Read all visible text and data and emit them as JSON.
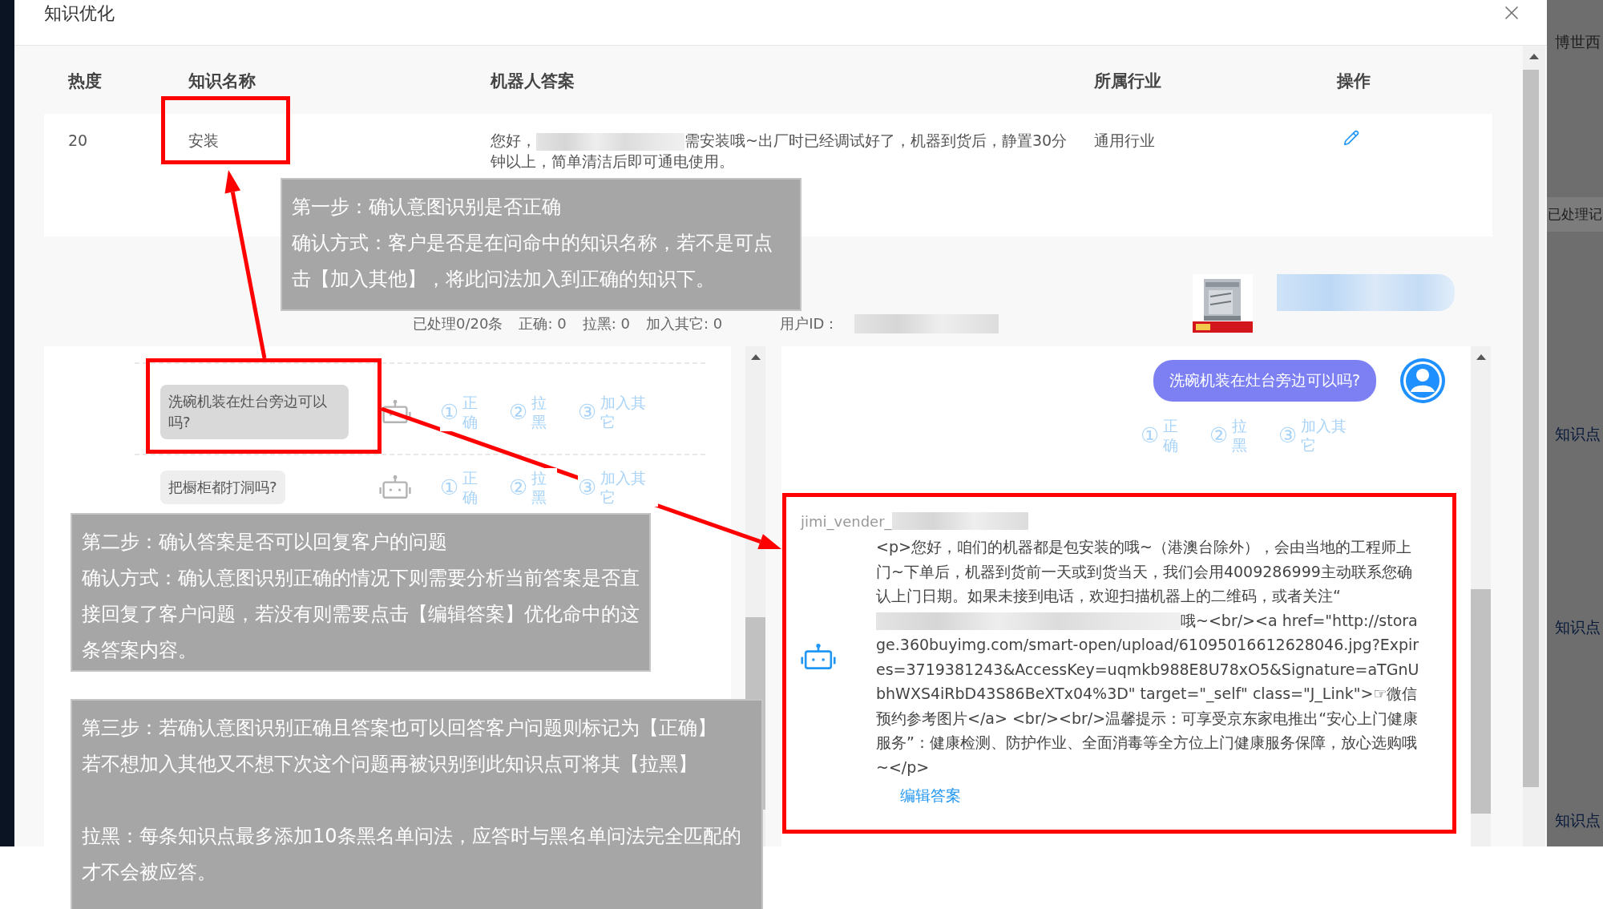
{
  "dialog": {
    "title": "知识优化"
  },
  "table": {
    "columns": [
      "热度",
      "知识名称",
      "机器人答案",
      "所属行业",
      "操作"
    ],
    "rows": [
      {
        "heat": "20",
        "name": "安装",
        "answer_start": "您好，",
        "answer_rest": "需安装哦~出厂时已经调试好了，机器到货后，静置30分钟以上，简单清洁后即可通电使用。",
        "industry": "通用行业"
      }
    ]
  },
  "stats": [
    "已处理0/20条",
    "正确: 0",
    "拉黑: 0",
    "加入其它: 0"
  ],
  "user_id_label": "用户ID：",
  "questions": [
    {
      "text": "洗碗机装在灶台旁边可以吗?",
      "options": [
        {
          "number": "①",
          "label": "正确"
        },
        {
          "number": "②",
          "label": "拉黑"
        },
        {
          "number": "③",
          "label": "加入其它"
        }
      ]
    },
    {
      "text": "把橱柜都打洞吗?",
      "options": [
        {
          "number": "①",
          "label": "正确"
        },
        {
          "number": "②",
          "label": "拉黑"
        },
        {
          "number": "③",
          "label": "加入其它"
        }
      ]
    }
  ],
  "chat": {
    "user_message": "洗碗机装在灶台旁边可以吗?",
    "options": [
      {
        "number": "①",
        "label": "正确"
      },
      {
        "number": "②",
        "label": "拉黑"
      },
      {
        "number": "③",
        "label": "加入其它"
      }
    ],
    "bot_name": "jimi_vender_",
    "answer_before": "<p>您好，咱们的机器都是包安装的哦~（港澳台除外），会由当地的工程师上门~下单后，机器到货前一天或到货当天，我们会用4009286999主动联系您确认上门日期。如果未接到电话，欢迎扫描机器上的二维码，或者关注“",
    "answer_after": "哦~<br/><a href=\"http://storage.360buyimg.com/smart-open/upload/61095016612628046.jpg?Expires=3719381243&AccessKey=uqmkb988E8U78xO5&Signature=aTGnUbhWXS4iRbD43S86BeXTx04%3D\" target=\"_self\" class=\"J_Link\">☞微信预约参考图片</a>  <br/><br/>温馨提示：可享受京东家电推出“安心上门健康服务”：健康检测、防护作业、全面消毒等全方位上门健康服务保障，放心选购哦~</p>",
    "edit_link": "编辑答案"
  },
  "notes": [
    {
      "blocks": [
        [
          "第一步：确认意图识别是否正确",
          "确认方式：客户是否是在问命中的知识名称，若不是可点击【加入其他】，将此问法加入到正确的知识下。"
        ]
      ]
    },
    {
      "blocks": [
        [
          "第二步：确认答案是否可以回复客户的问题",
          "确认方式：确认意图识别正确的情况下则需要分析当前答案是否直接回复了客户问题，若没有则需要点击【编辑答案】优化命中的这条答案内容。"
        ]
      ]
    },
    {
      "blocks": [
        [
          "第三步：若确认意图识别正确且答案也可以回答客户问题则标记为【正确】",
          "若不想加入其他又不想下次这个问题再被识别到此知识点可将其【拉黑】"
        ],
        [
          "拉黑：每条知识点最多添加10条黑名单问法，应答时与黑名单问法完全匹配的才不会被应答。"
        ]
      ]
    }
  ],
  "background_page": [
    {
      "kind": "label",
      "text": "博世西"
    },
    {
      "kind": "band",
      "text": "已处理记"
    },
    {
      "kind": "link",
      "text": "知识点"
    },
    {
      "kind": "link",
      "text": "知识点"
    },
    {
      "kind": "link",
      "text": "知识点"
    }
  ]
}
